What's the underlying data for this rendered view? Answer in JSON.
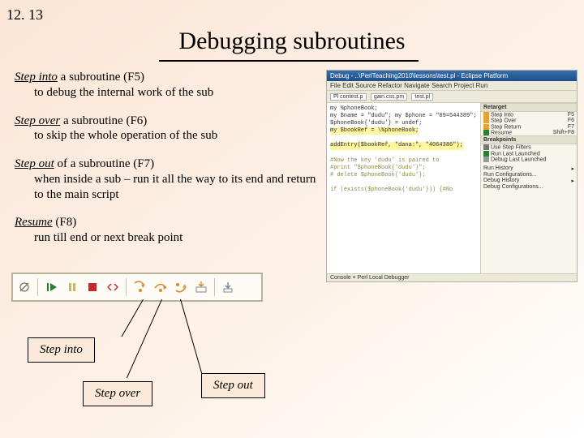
{
  "page_number": "12. 13",
  "title": "Debugging subroutines",
  "steps": [
    {
      "name": "Step into",
      "key": "(F5)",
      "lead": " a subroutine ",
      "desc": "to debug the internal work of the sub"
    },
    {
      "name": "Step over",
      "key": "(F6)",
      "lead": " a subroutine ",
      "desc": "to skip the whole operation of the sub"
    },
    {
      "name": "Step out",
      "key": "(F7)",
      "lead": " of a subroutine ",
      "desc": "when inside a sub – run it all the way to its end and return to the main script"
    },
    {
      "name": "Resume",
      "key": "(F8)",
      "lead": " ",
      "desc": "run till end or next break point"
    }
  ],
  "callouts": {
    "into": "Step into",
    "over": "Step over",
    "out": "Step out"
  },
  "shot": {
    "window_title": "Debug - ..\\PerlTeaching2010\\lessons\\test.pl - Eclipse Platform",
    "menubar": "File  Edit  Source  Refactor  Navigate  Search  Project  Run",
    "tabs": [
      "Pl contest.p",
      "gain.css.pm",
      "test.pl"
    ],
    "code": [
      {
        "t": "my %phoneBook;",
        "cls": ""
      },
      {
        "t": "my $name = \"dudu\";  my $phone = \"09=544389\";",
        "cls": ""
      },
      {
        "t": "$phoneBook{'dudu'} = undef;",
        "cls": ""
      },
      {
        "t": "my $bookRef = \\%phoneBook;",
        "cls": "hl"
      },
      {
        "t": "",
        "cls": ""
      },
      {
        "t": "addEntry($bookRef, \"dana:\", \"4064386\");",
        "cls": "hl"
      },
      {
        "t": "",
        "cls": ""
      },
      {
        "t": "#Now the key 'dudu' is paired to",
        "cls": "cmt"
      },
      {
        "t": "#print  \"$phoneBook{'dudu'}\";",
        "cls": "cmt"
      },
      {
        "t": "# delete $phoneBook{'dudu'};",
        "cls": "cmt"
      },
      {
        "t": "",
        "cls": ""
      },
      {
        "t": "if (exists($phoneBook{'dudu'})) {#No",
        "cls": "cmt"
      }
    ],
    "debug_menu": {
      "items": [
        {
          "label": "Step Into",
          "key": "F5"
        },
        {
          "label": "Step Over",
          "key": "F6"
        },
        {
          "label": "Step Return",
          "key": "F7"
        },
        {
          "label": "Resume",
          "key": "Shift+F8"
        }
      ],
      "show_step_filters": "Use Step Filters",
      "run_last": "Run Last Launched",
      "open_run": "Run Configurations...",
      "debug_last": "Debug Last Launched",
      "history": "Run History",
      "history2": "Debug History",
      "debug_cfg": "Debug Configurations..."
    },
    "retarget_title": "Retarget",
    "xbp": "Breakpoints",
    "console_hdr": "Console  ×    Perl Local Debugger"
  }
}
